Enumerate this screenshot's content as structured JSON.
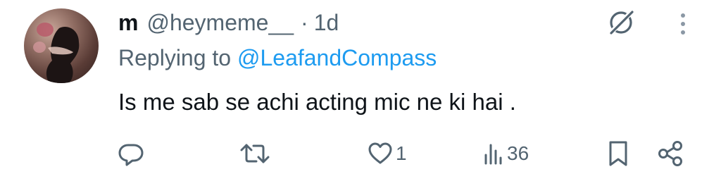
{
  "tweet": {
    "display_name": "m",
    "handle": "@heymeme__",
    "separator": "·",
    "timestamp": "1d",
    "replying_prefix": "Replying to",
    "replying_to": "@LeafandCompass",
    "text": "Is me sab se achi acting mic ne ki hai ."
  },
  "actions": {
    "reply": {
      "icon": "reply-icon",
      "count": ""
    },
    "retweet": {
      "icon": "retweet-icon",
      "count": ""
    },
    "like": {
      "icon": "heart-icon",
      "count": "1"
    },
    "views": {
      "icon": "analytics-icon",
      "count": "36"
    },
    "bookmark": {
      "icon": "bookmark-icon"
    },
    "share": {
      "icon": "share-icon"
    }
  },
  "header_icons": {
    "grok": "grok-icon",
    "more": "more-dots-icon"
  },
  "colors": {
    "text_primary": "#0f1419",
    "text_secondary": "#536471",
    "link": "#1d9bf0"
  }
}
